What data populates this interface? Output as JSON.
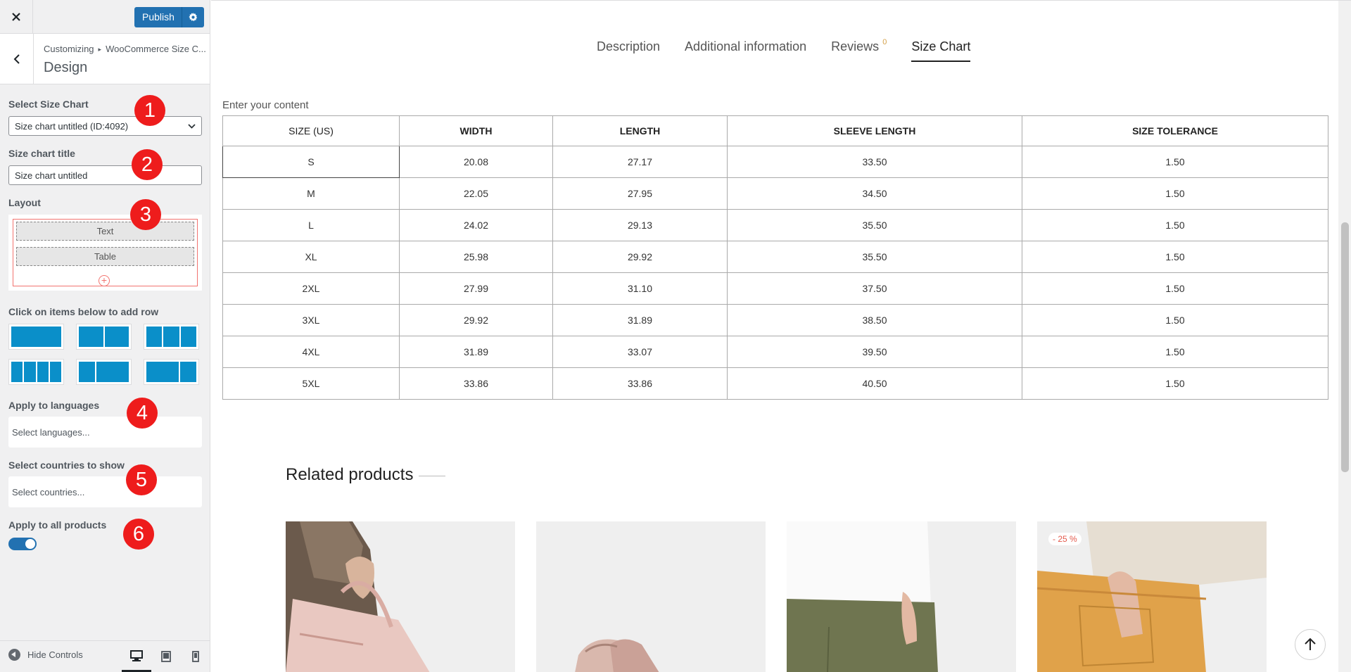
{
  "topbar": {
    "close_icon": "close-icon",
    "publish_label": "Publish",
    "settings_icon": "gear-icon"
  },
  "panel": {
    "breadcrumb_root": "Customizing",
    "breadcrumb_section": "WooCommerce Size C...",
    "title": "Design"
  },
  "controls": {
    "select_chart_label": "Select Size Chart",
    "select_chart_value": "Size chart untitled (ID:4092)",
    "title_label": "Size chart title",
    "title_value": "Size chart untitled",
    "layout_label": "Layout",
    "layout_items": [
      "Text",
      "Table"
    ],
    "add_row_label": "Click on items below to add row",
    "languages_label": "Apply to languages",
    "languages_placeholder": "Select languages...",
    "countries_label": "Select countries to show",
    "countries_placeholder": "Select countries...",
    "all_products_label": "Apply to all products",
    "all_products_on": true
  },
  "badges": [
    "1",
    "2",
    "3",
    "4",
    "5",
    "6"
  ],
  "footer": {
    "hide_controls": "Hide Controls"
  },
  "tabs": [
    {
      "label": "Description",
      "active": false
    },
    {
      "label": "Additional information",
      "active": false
    },
    {
      "label": "Reviews",
      "count": "0",
      "active": false
    },
    {
      "label": "Size Chart",
      "active": true
    }
  ],
  "content_text": "Enter your content",
  "size_table": {
    "headers": [
      "SIZE (US)",
      "WIDTH",
      "LENGTH",
      "SLEEVE LENGTH",
      "SIZE TOLERANCE"
    ],
    "rows": [
      [
        "S",
        "20.08",
        "27.17",
        "33.50",
        "1.50"
      ],
      [
        "M",
        "22.05",
        "27.95",
        "34.50",
        "1.50"
      ],
      [
        "L",
        "24.02",
        "29.13",
        "35.50",
        "1.50"
      ],
      [
        "XL",
        "25.98",
        "29.92",
        "35.50",
        "1.50"
      ],
      [
        "2XL",
        "27.99",
        "31.10",
        "37.50",
        "1.50"
      ],
      [
        "3XL",
        "29.92",
        "31.89",
        "38.50",
        "1.50"
      ],
      [
        "4XL",
        "31.89",
        "33.07",
        "39.50",
        "1.50"
      ],
      [
        "5XL",
        "33.86",
        "33.86",
        "40.50",
        "1.50"
      ]
    ]
  },
  "related": {
    "title": "Related products",
    "sale_badge": "- 25 %"
  }
}
